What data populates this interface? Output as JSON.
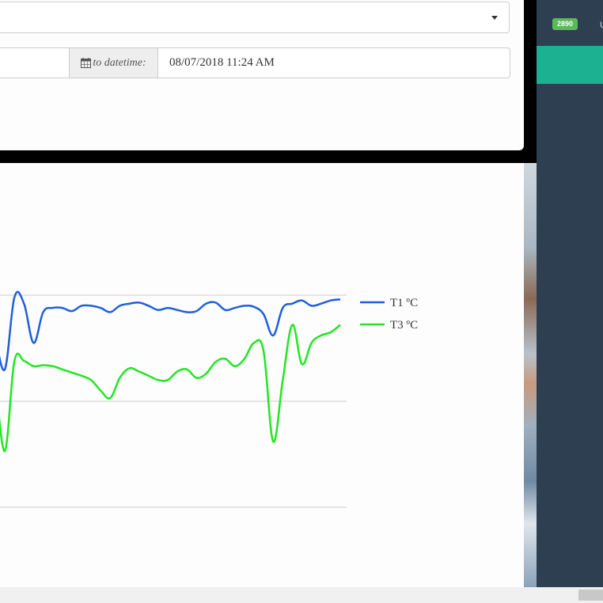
{
  "filter": {
    "selected_value": "",
    "to_datetime_label": "to datetime:",
    "to_datetime_value": "08/07/2018 11:24 AM"
  },
  "sidebar": {
    "badge": "2890",
    "item_text": "U"
  },
  "colors": {
    "series_t1": "#1f5fdc",
    "series_t3": "#22e622",
    "sidebar_bg": "#2f3f52",
    "sidebar_accent": "#1bb191",
    "badge_bg": "#5cb85c"
  },
  "chart_data": {
    "type": "line",
    "title": "",
    "xlabel": "",
    "ylabel": "",
    "legend_position": "top-right",
    "grid": true,
    "x": [
      0,
      1,
      2,
      3,
      4,
      5,
      6,
      7,
      8,
      9,
      10,
      11,
      12,
      13,
      14,
      15,
      16,
      17,
      18,
      19,
      20,
      21,
      22,
      23,
      24,
      25,
      26,
      27,
      28,
      29,
      30,
      31,
      32,
      33,
      34,
      35,
      36
    ],
    "series": [
      {
        "name": "T1 ºC",
        "color": "#1f5fdc",
        "values": [
          0.62,
          0.3,
          0.98,
          0.92,
          0.55,
          0.84,
          0.88,
          0.88,
          0.85,
          0.9,
          0.9,
          0.88,
          0.84,
          0.9,
          0.92,
          0.93,
          0.9,
          0.86,
          0.88,
          0.86,
          0.84,
          0.85,
          0.92,
          0.93,
          0.86,
          0.88,
          0.9,
          0.89,
          0.82,
          0.62,
          0.88,
          0.92,
          0.95,
          0.9,
          0.92,
          0.95,
          0.96
        ]
      },
      {
        "name": "T3 ºC",
        "color": "#22e622",
        "values": [
          0.22,
          -0.47,
          0.38,
          0.38,
          0.33,
          0.34,
          0.33,
          0.3,
          0.27,
          0.24,
          0.2,
          0.1,
          0.03,
          0.22,
          0.31,
          0.28,
          0.24,
          0.2,
          0.2,
          0.28,
          0.3,
          0.22,
          0.26,
          0.37,
          0.4,
          0.33,
          0.4,
          0.55,
          0.47,
          -0.38,
          0.2,
          0.72,
          0.35,
          0.55,
          0.62,
          0.65,
          0.72
        ]
      }
    ],
    "gridlines": [
      1,
      0,
      -1
    ],
    "ylim": [
      -1.25,
      1.0
    ]
  }
}
